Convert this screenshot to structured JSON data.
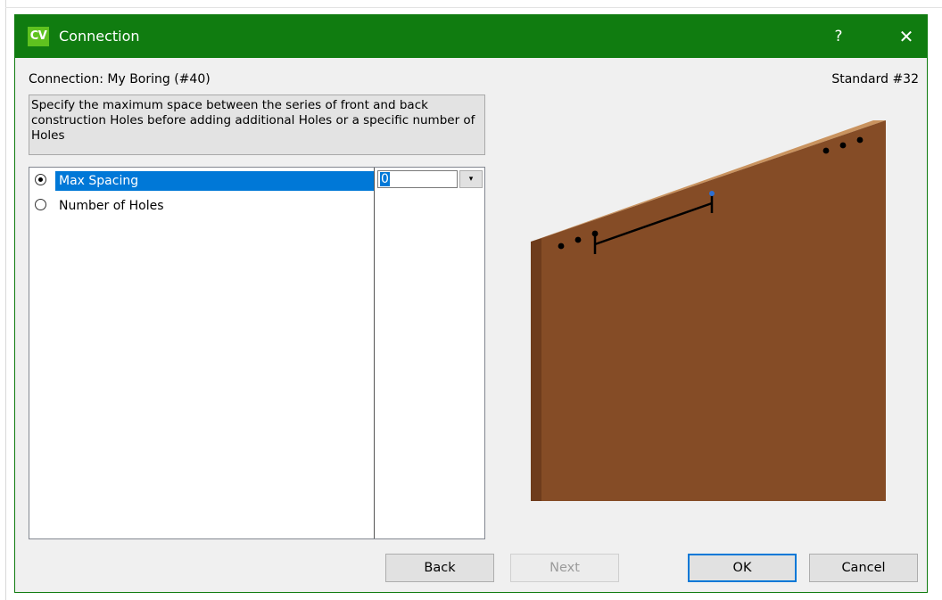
{
  "window": {
    "icon_text": "CV",
    "title": "Connection",
    "help_label": "?",
    "close_label": "✕"
  },
  "header": {
    "connection_label": "Connection: My Boring (#40)",
    "standard_label": "Standard #32"
  },
  "description": "Specify the maximum space between the series of front and back construction Holes before adding additional Holes or a specific number of Holes",
  "options": [
    {
      "label": "Max Spacing",
      "selected": true
    },
    {
      "label": "Number of Holes",
      "selected": false
    }
  ],
  "value_field": {
    "value": "0",
    "dropdown_glyph": "▾"
  },
  "buttons": {
    "back": "Back",
    "next": "Next",
    "ok": "OK",
    "cancel": "Cancel"
  },
  "colors": {
    "titlebar": "#107c10",
    "selection": "#0078d7",
    "panel_front": "#854c26",
    "panel_edge": "#6e3c1c",
    "panel_top": "#c9935f"
  }
}
